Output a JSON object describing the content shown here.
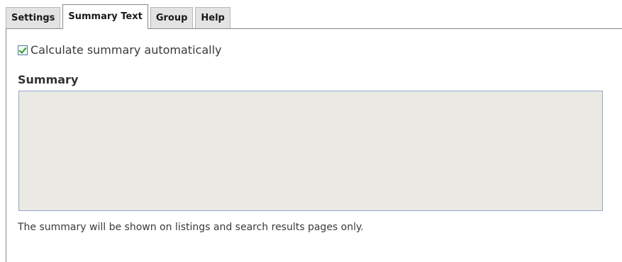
{
  "tabs": [
    {
      "label": "Settings",
      "active": false
    },
    {
      "label": "Summary Text",
      "active": true
    },
    {
      "label": "Group",
      "active": false
    },
    {
      "label": "Help",
      "active": false
    }
  ],
  "auto_summary": {
    "checked": true,
    "label": "Calculate summary automatically",
    "check_color": "#2e9a2e"
  },
  "summary": {
    "heading": "Summary",
    "value": "",
    "help": "The summary will be shown on listings and search results pages only."
  },
  "colors": {
    "textarea_background": "#ebe9e4",
    "textarea_border": "#8fa9c6",
    "tab_background": "#e3e3e3"
  }
}
